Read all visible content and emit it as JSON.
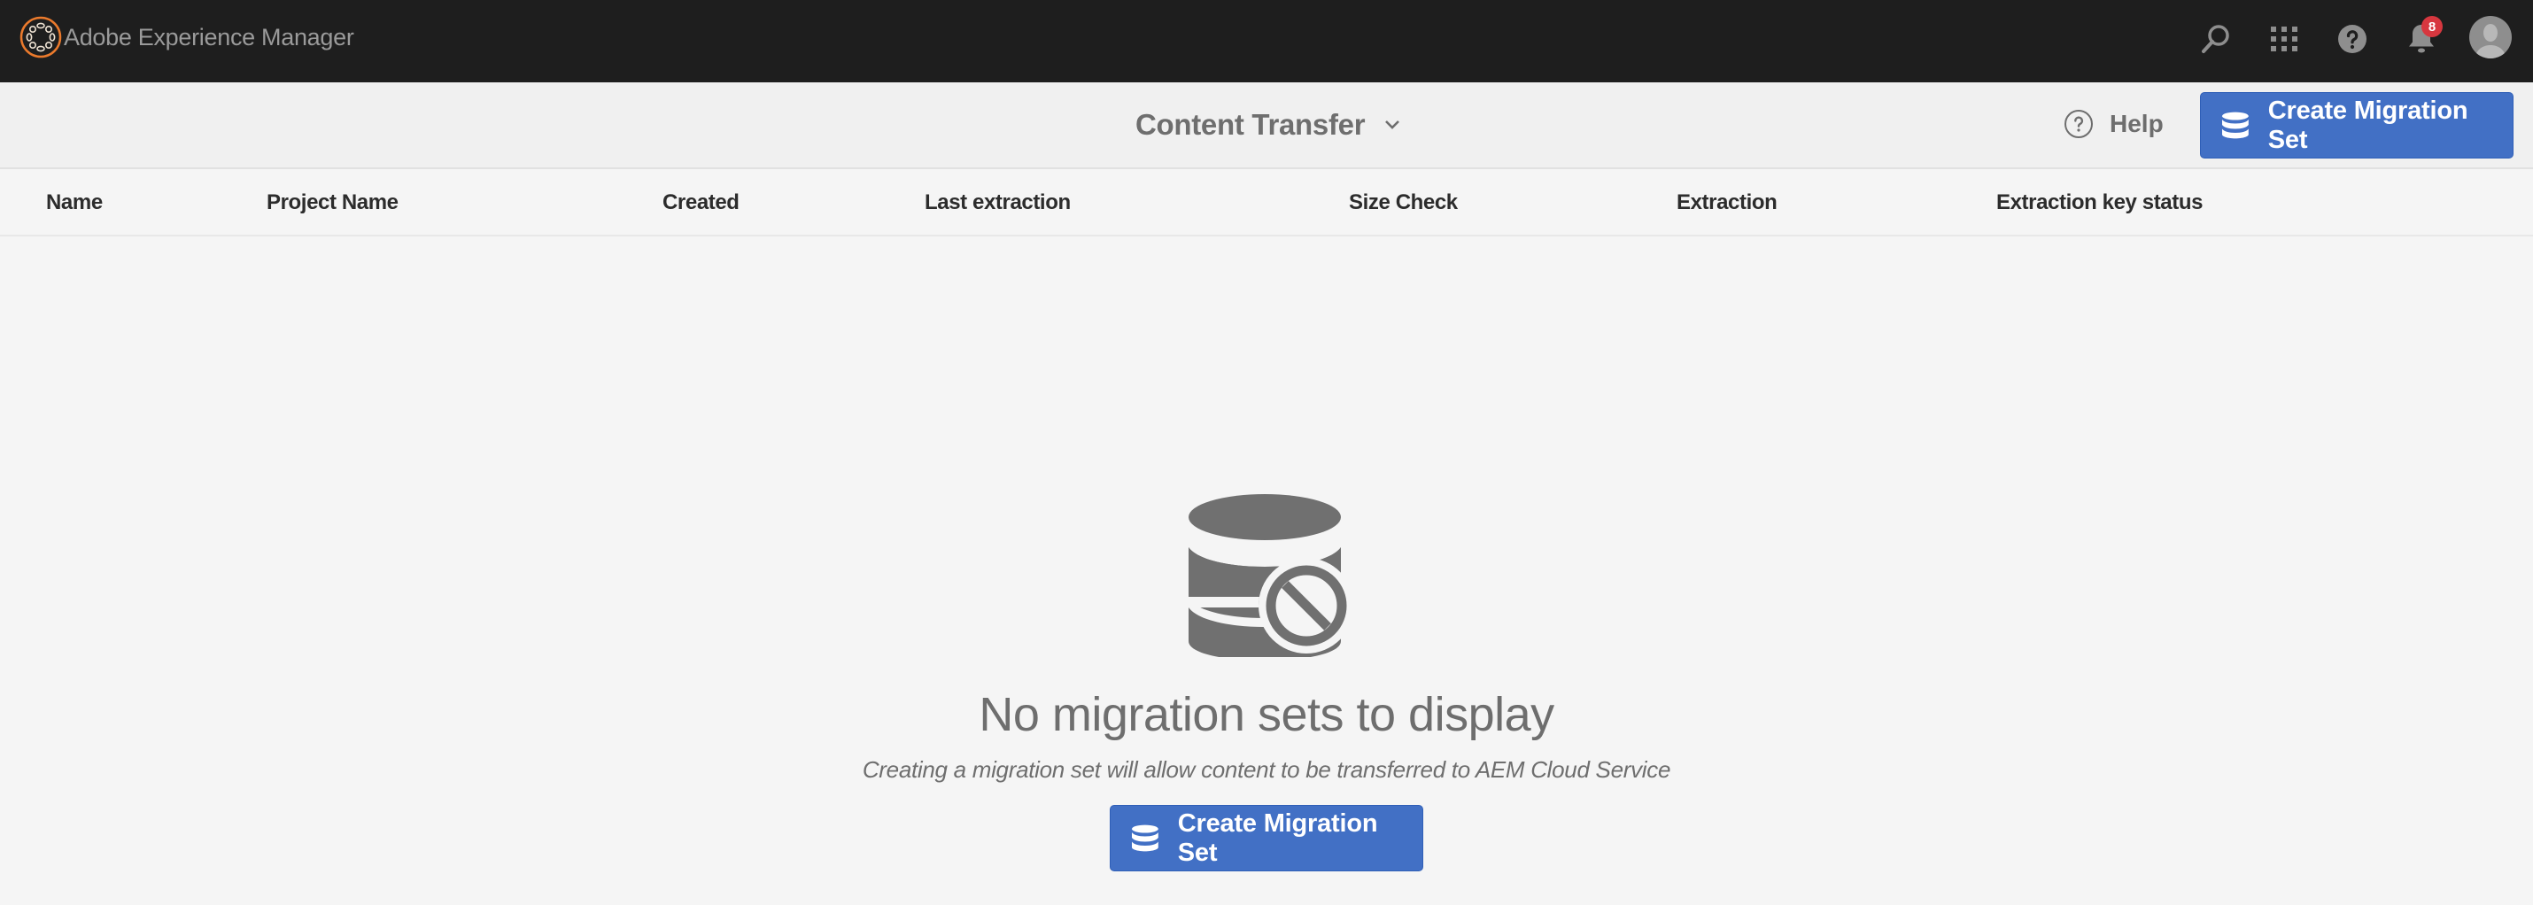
{
  "shell": {
    "app_title": "Adobe Experience Manager",
    "icons": [
      "search-icon",
      "apps-grid-icon",
      "help-icon",
      "notifications-bell-icon",
      "user-avatar"
    ],
    "notification_count": "8",
    "brand_color": "#eb7a2c",
    "badge_color": "#d7373f"
  },
  "actionbar": {
    "title": "Content Transfer",
    "help_label": "Help",
    "create_label": "Create Migration Set",
    "accent_color": "#4270c5"
  },
  "table": {
    "columns": [
      "Name",
      "Project Name",
      "Created",
      "Last extraction",
      "Size Check",
      "Extraction",
      "Extraction key status"
    ],
    "rows": []
  },
  "empty_state": {
    "icon": "database-blocked-icon",
    "title": "No migration sets to display",
    "subtitle": "Creating a migration set will allow content to be transferred to AEM Cloud Service",
    "button_label": "Create Migration Set"
  }
}
